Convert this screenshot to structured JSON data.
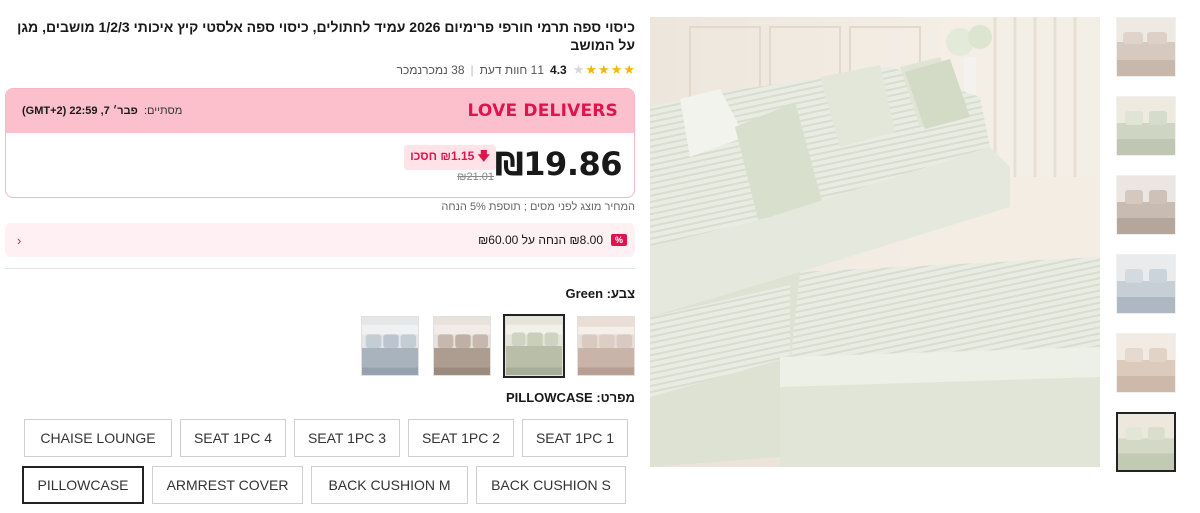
{
  "product": {
    "title": "כיסוי ספה תרמי חורפי פרימיום 2026 עמיד לחתולים, כיסוי ספה אלסטי קיץ איכותי 1/2/3 מושבים, מגן על המושב",
    "rating": "4.3",
    "stars_filled": 4,
    "reviews": "11 חוות דעת",
    "sold": "38 נמכרנמכר"
  },
  "deal": {
    "title": "LOVE DELIVERS",
    "ends_label": "מסתיים",
    "ends_time": "פבר׳ 7, 22:59 (GMT+2)"
  },
  "price": {
    "current": "₪19.86",
    "save": "₪1.15 חסכו",
    "original": "₪21.01",
    "tax_note": "המחיר מוצג לפני מסים ; תוספת 5% הנחה"
  },
  "coupon": {
    "text": "₪8.00 הנחה על ₪60.00",
    "icon": "coupon-icon"
  },
  "color": {
    "label": "צבע:",
    "value": "Green",
    "swatch_names": [
      "Beige",
      "Green",
      "Brown",
      "Blue"
    ],
    "selected_index": 1
  },
  "spec": {
    "label": "מפרט:",
    "value": "PILLOWCASE",
    "options_row1": [
      "SEAT 1PC 1",
      "SEAT 1PC 2",
      "SEAT 1PC 3",
      "SEAT 1PC 4",
      "CHAISE LOUNGE"
    ],
    "options_row2": [
      "BACK CUSHION S",
      "BACK CUSHION M",
      "ARMREST COVER",
      "PILLOWCASE"
    ],
    "selected": "PILLOWCASE"
  },
  "gallery": {
    "thumbnail_count": 6,
    "active_index": 5
  },
  "colors": {
    "accent": "#e0144d",
    "banner": "#fcc0cd",
    "star": "#f6b603"
  }
}
